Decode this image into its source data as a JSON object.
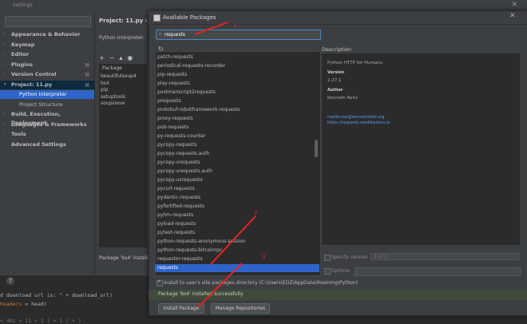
{
  "settings": {
    "title": "Settings",
    "nav": [
      {
        "label": "Appearance & Behavior",
        "type": "section"
      },
      {
        "label": "Keymap",
        "type": "section"
      },
      {
        "label": "Editor",
        "type": "section"
      },
      {
        "label": "Plugins",
        "type": "section"
      },
      {
        "label": "Version Control",
        "type": "section"
      },
      {
        "label": "Project: 11.py",
        "type": "section"
      },
      {
        "label": "Python Interpreter",
        "type": "sub",
        "selected": true
      },
      {
        "label": "Project Structure",
        "type": "sub"
      },
      {
        "label": "Build, Execution, Deployment",
        "type": "section"
      },
      {
        "label": "Languages & Frameworks",
        "type": "section"
      },
      {
        "label": "Tools",
        "type": "section"
      },
      {
        "label": "Advanced Settings",
        "type": "section"
      }
    ],
    "content": {
      "header": "Project: 11.py  ›  Pyt",
      "interpreter_label": "Python Interpreter:",
      "table_header": "Package",
      "packages": [
        "beautifulsoup4",
        "bs4",
        "pip",
        "setuptools",
        "soupsieve"
      ],
      "status": "Package 'bs4' installed"
    }
  },
  "dialog": {
    "title": "Available Packages",
    "search_value": "requests",
    "items": [
      "patch-requests",
      "periodical-requests-recorder",
      "pip-requests",
      "play-requests",
      "postmanscript2requests",
      "prequests",
      "protobuf-robotframework-requests",
      "proxy-requests",
      "pub-requests",
      "py-requests-counter",
      "pycopy-requests",
      "pycopy-requests.auth",
      "pycopy-urequests",
      "pycopy-urequests.auth",
      "pycopy-usrequests",
      "pycurl-requests",
      "pydantic-requests",
      "pyfortified-requests",
      "pyhm-requests",
      "pyload-requests",
      "pytest-requests",
      "python-requests-anonymous-session",
      "python-requests-bitcoinrpc",
      "requestor-requests",
      "requests"
    ],
    "selected_item": "requests",
    "description": {
      "label": "Description",
      "summary": "Python HTTP for Humans.",
      "version_key": "Version",
      "version": "2.27.1",
      "author_key": "Author",
      "author": "Kenneth Reitz",
      "email": "mailto:me@kennethreitz.org",
      "url": "https://requests.readthedocs.io"
    },
    "specify_version_label": "Specify version",
    "specify_version_value": "2.27.1",
    "options_label": "Options",
    "install_user_label": "Install to user's site packages directory (C:\\Users\\EDZ\\AppData\\Roaming\\Python)",
    "status": "Package 'bs4' installed successfully",
    "install_button": "Install Package",
    "manage_button": "Manage Repositories"
  },
  "terminal": {
    "line1": "d download url is: \" + download_url)",
    "line2_keyword": "headers",
    "line2_rest": " = head)",
    "line3": "< 401 > 11 < 1 ( > 1 ( > )"
  },
  "annotations": [
    "1",
    "2",
    "3"
  ],
  "colors": {
    "annotation": "#e8231f",
    "selection": "#2f65ca",
    "link": "#589df6"
  }
}
